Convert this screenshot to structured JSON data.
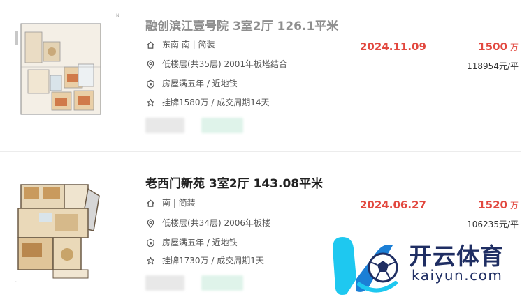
{
  "listings": [
    {
      "title": "融创滨江壹号院 3室2厅 126.1平米",
      "orientation": "东南 南 | 简装",
      "floor": "低楼层(共35层) 2001年板塔结合",
      "tags": "房屋满五年 / 近地铁",
      "listing_info": "挂牌1580万 / 成交周期14天",
      "deal_date": "2024.11.09",
      "total_price": "1500",
      "price_unit": "万",
      "unit_price": "118954元/平"
    },
    {
      "title": "老西门新苑 3室2厅 143.08平米",
      "orientation": "南 | 简装",
      "floor": "低楼层(共34层) 2006年板楼",
      "tags": "房屋满五年 / 近地铁",
      "listing_info": "挂牌1730万 / 成交周期1天",
      "deal_date": "2024.06.27",
      "total_price": "1520",
      "price_unit": "万",
      "unit_price": "106235元/平"
    }
  ],
  "watermark": {
    "name_cn": "开云体育",
    "name_en": "kaiyun.com"
  },
  "colors": {
    "accent_red": "#e2483f",
    "watermark_blue": "#1f2e63",
    "watermark_cyan": "#1ec8f0"
  }
}
